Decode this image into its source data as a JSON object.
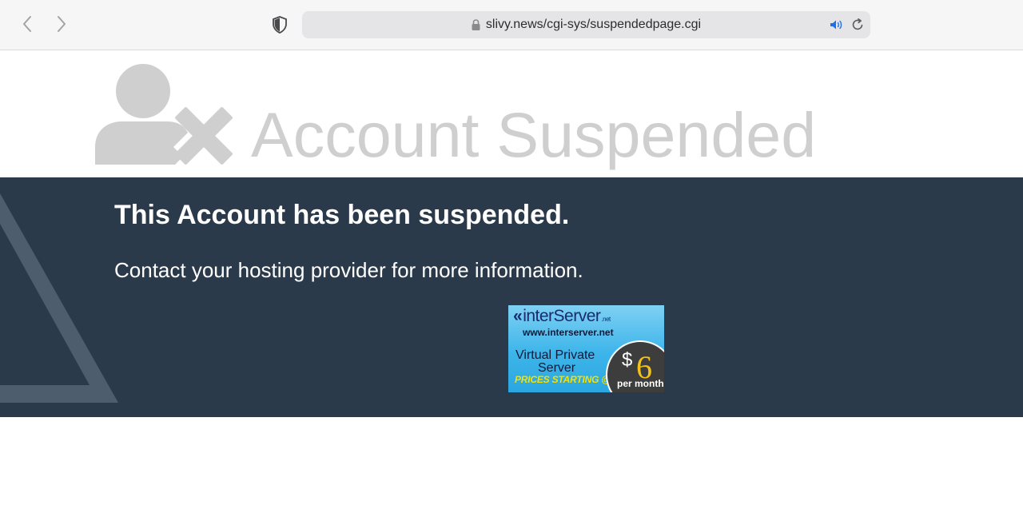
{
  "browser": {
    "url": "slivy.news/cgi-sys/suspendedpage.cgi",
    "icons": {
      "back": "chevron-left-icon",
      "forward": "chevron-right-icon",
      "privacy": "shield-icon",
      "secure": "lock-icon",
      "audio": "speaker-icon",
      "reload": "reload-icon"
    }
  },
  "hero": {
    "title": "Account Suspended",
    "icon": "user-x-icon"
  },
  "band": {
    "headline": "This Account has been suspended.",
    "subline": "Contact your hosting provider for more information."
  },
  "ad": {
    "logo_text": "interServer",
    "logo_suffix": ".net",
    "url": "www.interserver.net",
    "line1": "Virtual Private",
    "line2": "Server",
    "prices": "PRICES STARTING @",
    "currency": "$",
    "price": "6",
    "period": "per month"
  },
  "colors": {
    "toolbar_bg": "#f6f6f7",
    "address_bg": "#e5e5e7",
    "hero_gray": "#cfcfcf",
    "band_bg": "#2b3a4b",
    "triangle": "#4d5d6d",
    "audio_blue": "#1e6fe8"
  }
}
